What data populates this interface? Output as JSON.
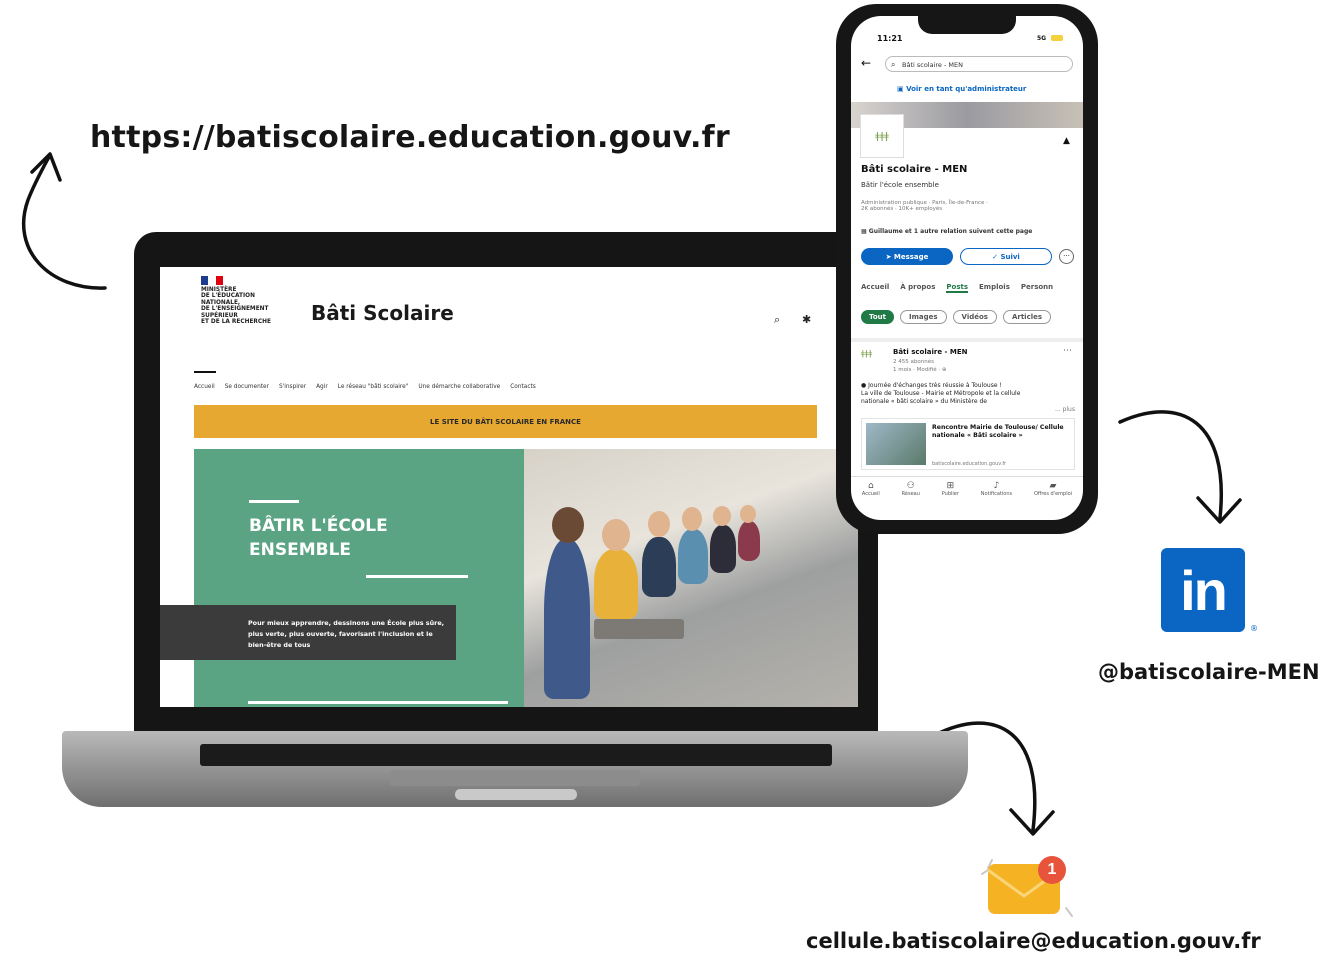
{
  "url": "https://batiscolaire.education.gouv.fr",
  "linkedin_handle": "@batiscolaire-MEN",
  "email": "cellule.batiscolaire@education.gouv.fr",
  "mail_badge_count": "1",
  "linkedin_logo_text": "in",
  "colors": {
    "accent_yellow": "#e6a830",
    "hero_green": "#5aa484",
    "linkedin_blue": "#0a66c2"
  },
  "website": {
    "ministry_lines": [
      "MINISTÈRE",
      "DE L'ÉDUCATION",
      "NATIONALE,",
      "DE L'ENSEIGNEMENT",
      "SUPÉRIEUR",
      "ET DE LA RECHERCHE"
    ],
    "title": "Bâti Scolaire",
    "nav": [
      "Accueil",
      "Se documenter",
      "S'inspirer",
      "Agir",
      "Le réseau \"bâti scolaire\"",
      "Une démarche collaborative",
      "Contacts"
    ],
    "banner": "LE SITE DU BÂTI SCOLAIRE EN FRANCE",
    "hero_title_1": "BÂTIR L'ÉCOLE",
    "hero_title_2": "ENSEMBLE",
    "hero_desc": "Pour mieux apprendre, dessinons une École plus sûre, plus verte, plus ouverte, favorisant l'inclusion et le bien-être de tous"
  },
  "phone": {
    "time": "11:21",
    "signal": "5G",
    "search": "Bâti scolaire - MEN",
    "admin_link": "Voir en tant qu'administrateur",
    "page_name": "Bâti scolaire - MEN",
    "tagline": "Bâtir l'école ensemble",
    "meta1": "Administration publique · Paris, Île-de-France ·",
    "meta2": "2K abonnés · 10K+ employés",
    "followers_note": "Guillaume et 1 autre relation suivent cette page",
    "btn_message": "Message",
    "btn_follow": "✓ Suivi",
    "tabs": [
      "Accueil",
      "À propos",
      "Posts",
      "Emplois",
      "Personn"
    ],
    "filters": [
      "Tout",
      "Images",
      "Vidéos",
      "Articles"
    ],
    "post_author": "Bâti scolaire - MEN",
    "post_followers": "2 455 abonnés",
    "post_time": "1 mois · Modifié · ⊕",
    "post_text1": "Journée d'échanges très réussie à Toulouse !",
    "post_text2": "La ville de Toulouse - Mairie et Métropole et la cellule",
    "post_text3": "nationale « bâti scolaire » du Ministère de",
    "post_more": "... plus",
    "card_title": "Rencontre Mairie de Toulouse/ Cellule nationale « Bâti scolaire »",
    "card_url": "batiscolaire.education.gouv.fr",
    "bottom_nav": [
      "Accueil",
      "Réseau",
      "Publier",
      "Notifications",
      "Offres d'emploi"
    ]
  }
}
